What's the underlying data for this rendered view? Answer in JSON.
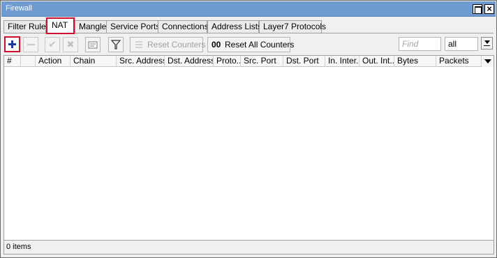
{
  "window": {
    "title": "Firewall",
    "colors": {
      "titlebar": "#6f9bd1",
      "highlight": "#d0102c",
      "add_icon": "#1c3aa5"
    }
  },
  "tabs": [
    {
      "label": "Filter Rules",
      "active": false
    },
    {
      "label": "NAT",
      "active": true
    },
    {
      "label": "Mangle",
      "active": false
    },
    {
      "label": "Service Ports",
      "active": false
    },
    {
      "label": "Connections",
      "active": false
    },
    {
      "label": "Address Lists",
      "active": false
    },
    {
      "label": "Layer7 Protocols",
      "active": false
    }
  ],
  "toolbar": {
    "add_icon": "plus-icon",
    "remove_icon": "minus-icon",
    "enable_icon": "check-icon",
    "disable_icon": "x-icon",
    "comment_icon": "comment-icon",
    "filter_icon": "filter-icon",
    "reset_counters_label": "Reset Counters",
    "reset_all_counters_label": "Reset All Counters",
    "reset_all_prefix": "00",
    "find_placeholder": "Find",
    "filter_value": "all"
  },
  "table": {
    "columns": [
      "#",
      "",
      "Action",
      "Chain",
      "Src. Address",
      "Dst. Address",
      "Proto...",
      "Src. Port",
      "Dst. Port",
      "In. Inter...",
      "Out. Int...",
      "Bytes",
      "Packets"
    ],
    "rows": []
  },
  "status": {
    "text": "0 items"
  }
}
